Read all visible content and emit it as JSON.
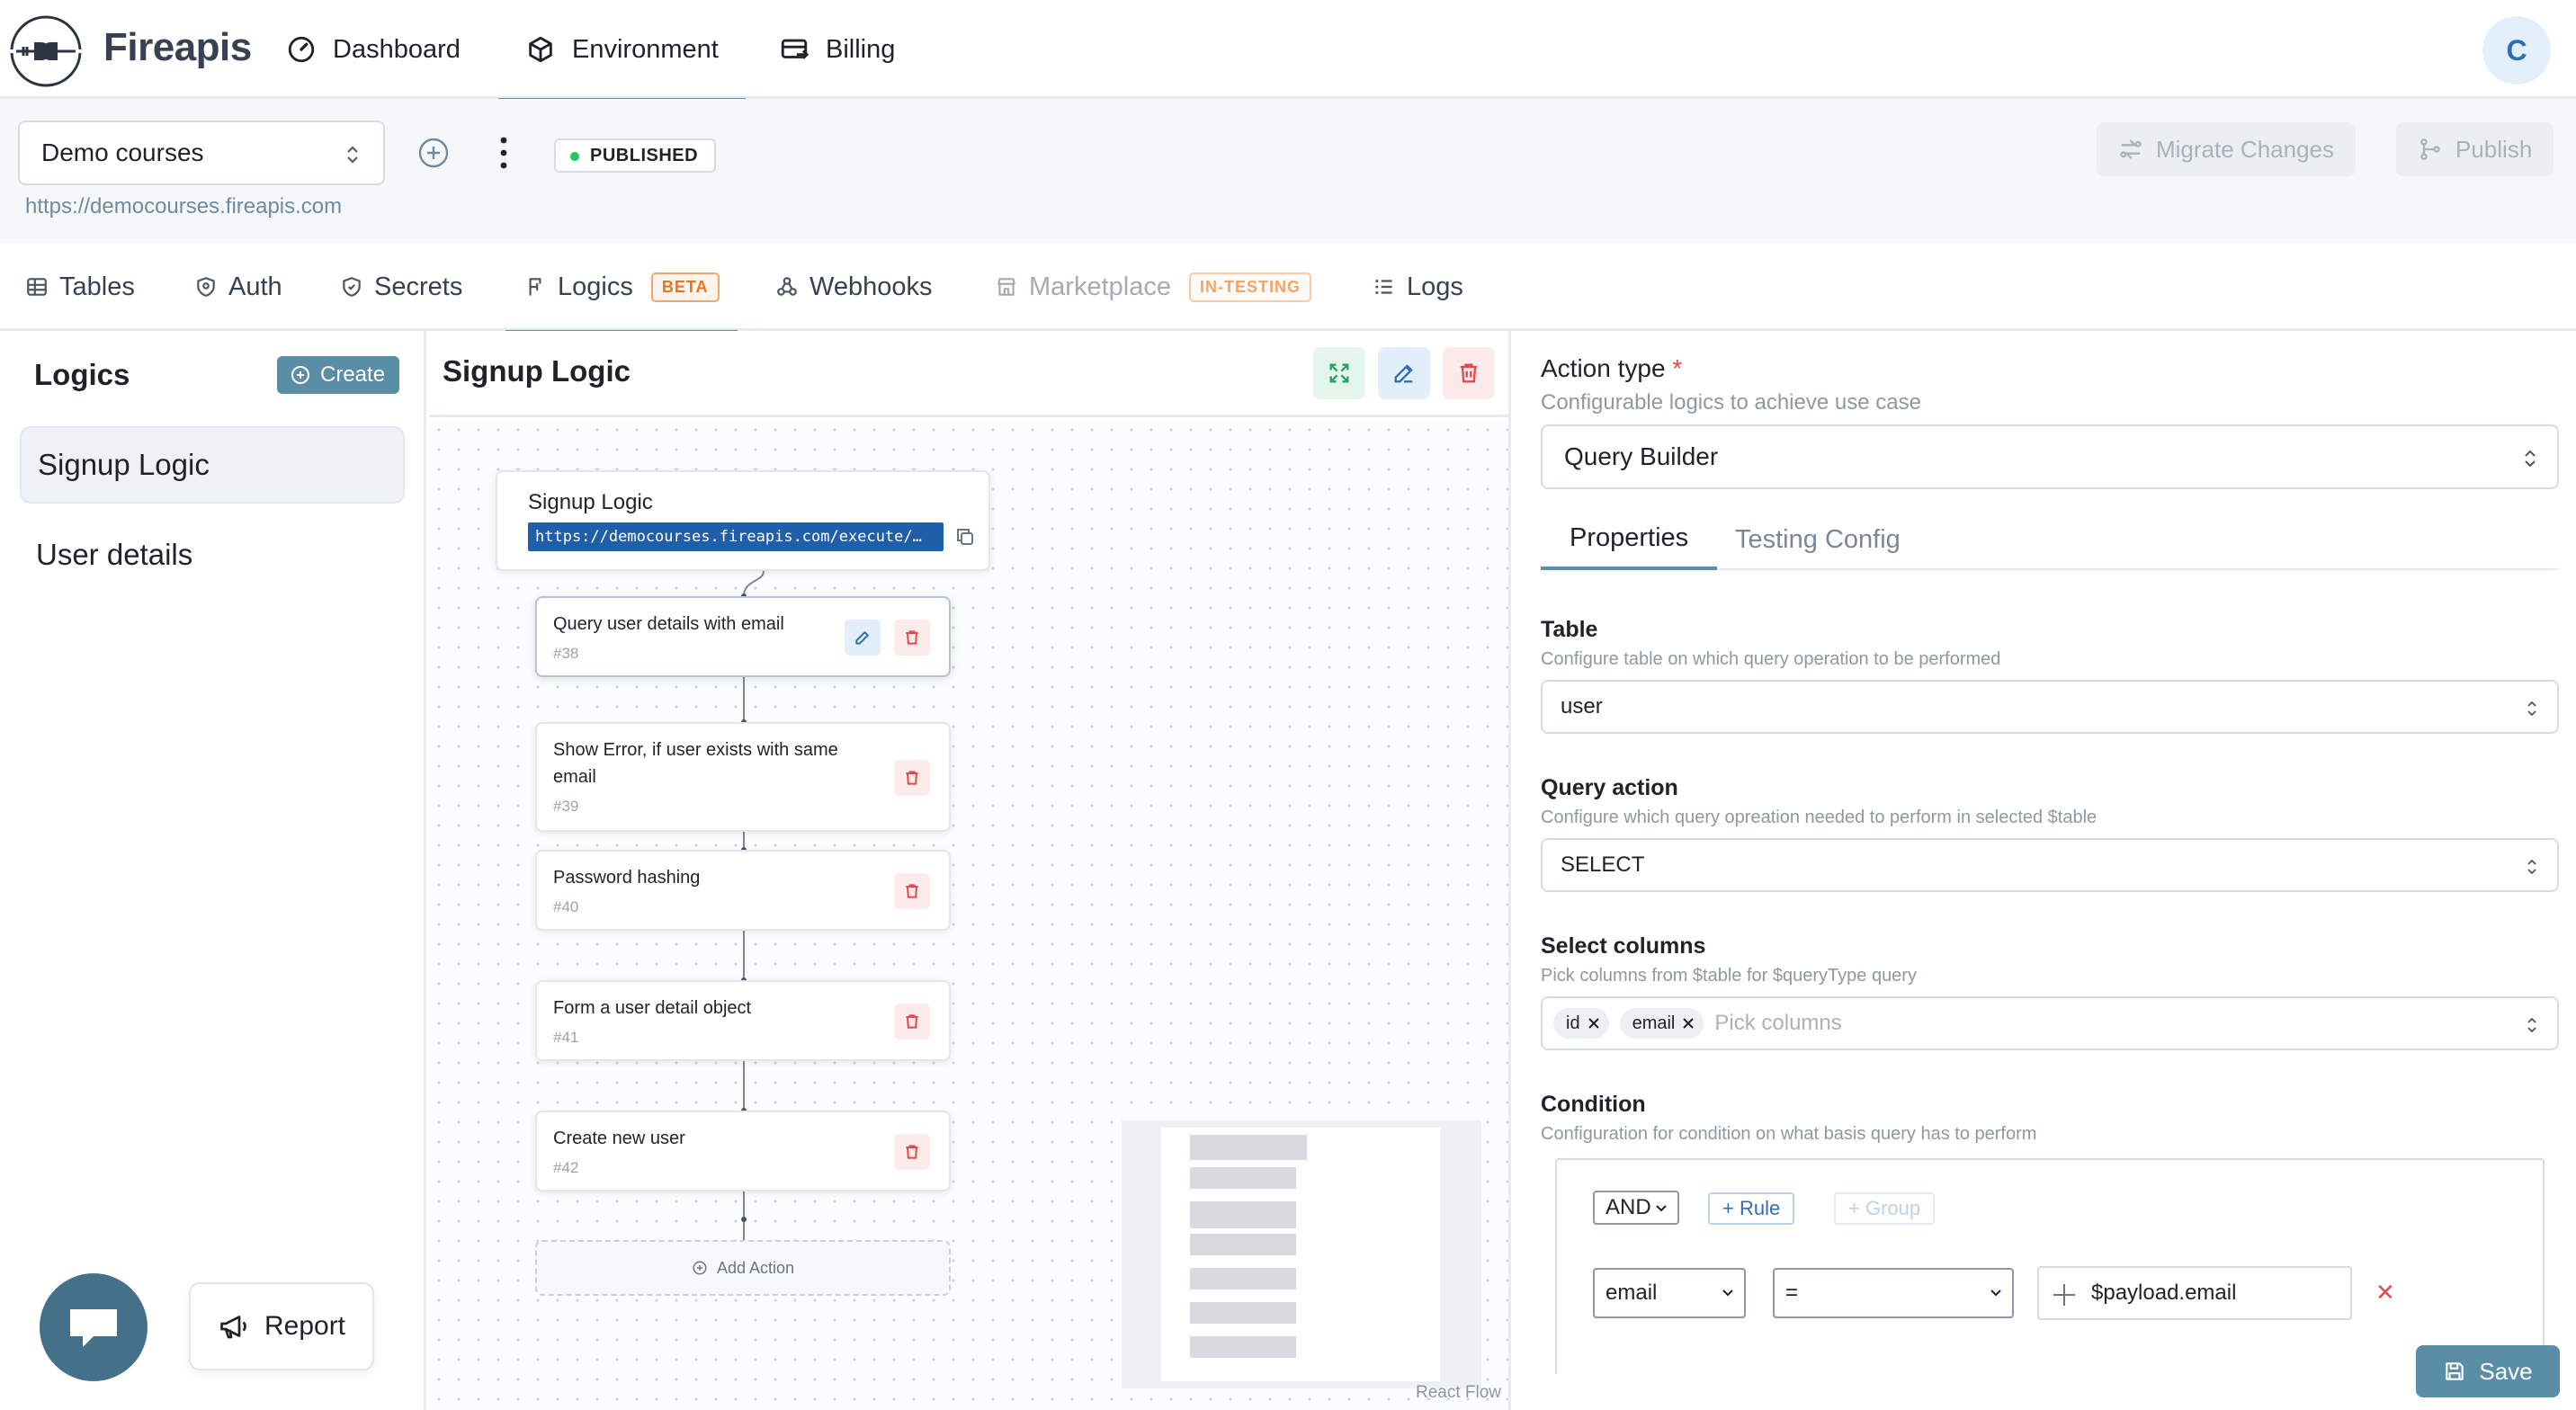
{
  "brand": {
    "name": "Fireapis"
  },
  "topnav": {
    "items": [
      {
        "label": "Dashboard",
        "icon": "gauge-icon"
      },
      {
        "label": "Environment",
        "icon": "cube-icon"
      },
      {
        "label": "Billing",
        "icon": "billing-icon"
      }
    ],
    "active": "Environment",
    "avatar_initial": "C"
  },
  "project": {
    "selected": "Demo courses",
    "url": "https://democourses.fireapis.com",
    "status": "PUBLISHED",
    "migrate_label": "Migrate Changes",
    "publish_label": "Publish"
  },
  "subtabs": [
    {
      "label": "Tables",
      "icon": "table-icon"
    },
    {
      "label": "Auth",
      "icon": "auth-icon"
    },
    {
      "label": "Secrets",
      "icon": "shield-icon"
    },
    {
      "label": "Logics",
      "icon": "logic-icon",
      "tag": "BETA"
    },
    {
      "label": "Webhooks",
      "icon": "webhook-icon"
    },
    {
      "label": "Marketplace",
      "icon": "store-icon",
      "tag": "IN-TESTING"
    },
    {
      "label": "Logs",
      "icon": "list-icon"
    }
  ],
  "logics_panel": {
    "title": "Logics",
    "create_label": "Create",
    "items": [
      "Signup Logic",
      "User details"
    ],
    "selected": "Signup Logic",
    "report_label": "Report"
  },
  "flow": {
    "title": "Signup Logic",
    "head": {
      "title": "Signup Logic",
      "url": "https://democourses.fireapis.com/execute/…"
    },
    "nodes": [
      {
        "title": "Query user details with email",
        "id": "#38"
      },
      {
        "title": "Show Error, if user exists with same email",
        "id": "#39"
      },
      {
        "title": "Password hashing",
        "id": "#40"
      },
      {
        "title": "Form a user detail object",
        "id": "#41"
      },
      {
        "title": "Create new user",
        "id": "#42"
      }
    ],
    "add_action_label": "Add Action",
    "attribution": "React Flow"
  },
  "action_panel": {
    "action_type_label": "Action type",
    "required_mark": "*",
    "action_type_help": "Configurable logics to achieve use case",
    "action_type_value": "Query Builder",
    "tabs": [
      "Properties",
      "Testing Config"
    ],
    "active_tab": "Properties",
    "table": {
      "label": "Table",
      "help": "Configure table on which query operation to be performed",
      "value": "user"
    },
    "query_action": {
      "label": "Query action",
      "help": "Configure which query opreation needed to perform in selected $table",
      "value": "SELECT"
    },
    "select_columns": {
      "label": "Select columns",
      "help": "Pick columns from $table for $queryType query",
      "chips": [
        "id",
        "email"
      ],
      "placeholder": "Pick columns"
    },
    "condition": {
      "label": "Condition",
      "help": "Configuration for condition on what basis query has to perform",
      "combinator": "AND",
      "add_rule_label": "+ Rule",
      "add_group_label": "+ Group",
      "rule": {
        "field": "email",
        "operator": "=",
        "value": "$payload.email"
      },
      "remove_glyph": "✕"
    },
    "save_label": "Save"
  },
  "colors": {
    "accent": "#5a8ea6",
    "danger": "#e5484d",
    "success": "#22c55e",
    "url_bg": "#1f5ea8"
  }
}
